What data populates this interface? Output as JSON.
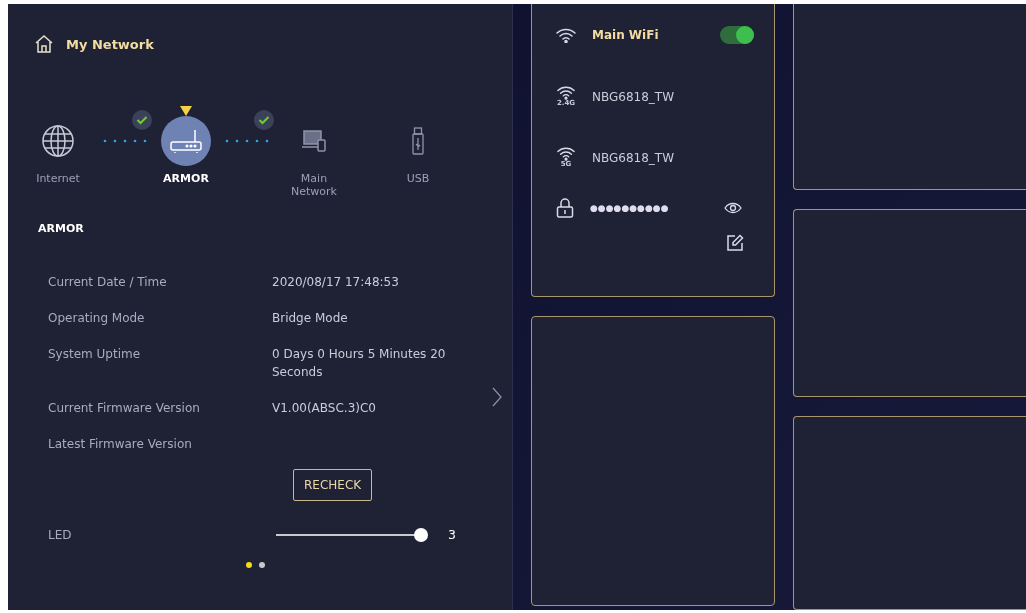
{
  "header": {
    "title": "My Network"
  },
  "topology": {
    "nodes": [
      {
        "kind": "globe",
        "label": "Internet",
        "selected": false
      },
      {
        "kind": "router",
        "label": "ARMOR",
        "selected": true
      },
      {
        "kind": "devices",
        "label": "Main Network",
        "selected": false
      },
      {
        "kind": "usb",
        "label": "USB",
        "selected": false
      }
    ],
    "links": [
      {
        "ok": true
      },
      {
        "ok": true
      }
    ]
  },
  "details": {
    "title": "ARMOR",
    "rows": [
      {
        "label": "Current Date / Time",
        "value": "2020/08/17 17:48:53"
      },
      {
        "label": "Operating Mode",
        "value": "Bridge Mode"
      },
      {
        "label": "System Uptime",
        "value": "0 Days 0 Hours 5 Minutes 20 Seconds"
      },
      {
        "label": "Current Firmware Version",
        "value": "V1.00(ABSC.3)C0"
      },
      {
        "label": "Latest Firmware Version",
        "button": "RECHECK"
      }
    ],
    "led": {
      "label": "LED",
      "level": 1,
      "reading": "3"
    }
  },
  "pager": [
    {
      "selected": true
    },
    {
      "selected": false
    }
  ],
  "wifi": {
    "title": "Main WiFi",
    "on": true,
    "networks": [
      {
        "band": "2.4G",
        "ssid": "NBG6818_TW"
      },
      {
        "band": "5G",
        "ssid": "NBG6818_TW"
      }
    ],
    "password": "●●●●●●●●●●"
  }
}
